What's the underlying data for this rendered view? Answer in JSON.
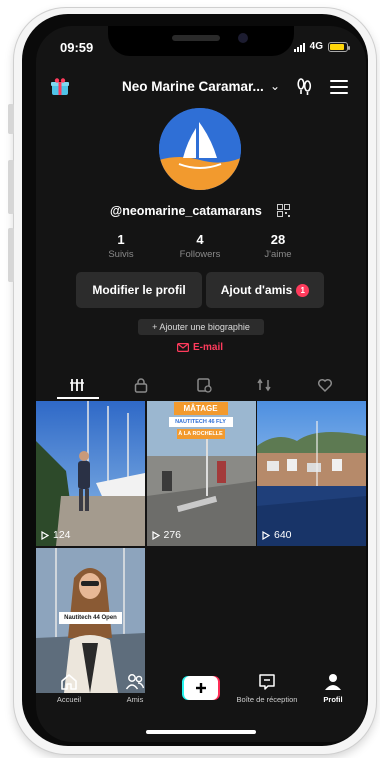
{
  "status": {
    "time": "09:59",
    "network": "4G"
  },
  "profile": {
    "account_name": "Neo Marine Caramar...",
    "username": "@neomarine_catamarans",
    "stats": [
      {
        "value": "1",
        "label": "Suivis"
      },
      {
        "value": "4",
        "label": "Followers"
      },
      {
        "value": "28",
        "label": "J'aime"
      }
    ],
    "edit_button": "Modifier le profil",
    "friends_button": "Ajout d'amis",
    "friends_badge": "1",
    "bio_button": "+ Ajouter une biographie",
    "email": "E-mail"
  },
  "tabs": [
    "videos-grid-icon",
    "lock-icon",
    "saved-icon",
    "repost-icon",
    "liked-icon"
  ],
  "videos": [
    {
      "views": "124"
    },
    {
      "views": "276",
      "banner": "MÂTAGE",
      "subtitle1": "NAUTITECH 46 FLY",
      "subtitle2": "À LA ROCHELLE"
    },
    {
      "views": "640"
    },
    {
      "views": "",
      "caption": "Nautitech 44 Open"
    }
  ],
  "nav": [
    {
      "label": "Accueil",
      "icon": "home-icon"
    },
    {
      "label": "Amis",
      "icon": "friends-icon"
    },
    {
      "label": "",
      "icon": "plus-icon"
    },
    {
      "label": "Boîte de réception",
      "icon": "inbox-icon"
    },
    {
      "label": "Profil",
      "icon": "profile-icon"
    }
  ],
  "colors": {
    "accent": "#ff3b5c",
    "background": "#141414",
    "button": "#2c2c2c",
    "avatar_blue": "#2f6fd6",
    "avatar_orange": "#f29a2e"
  }
}
